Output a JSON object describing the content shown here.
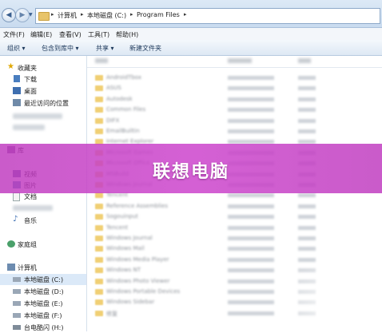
{
  "address": {
    "crumbs": [
      "计算机",
      "本地磁盘 (C:)",
      "Program Files"
    ]
  },
  "menu": [
    "文件(F)",
    "编辑(E)",
    "查看(V)",
    "工具(T)",
    "帮助(H)"
  ],
  "toolbar": [
    "组织 ▾",
    "包含到库中 ▾",
    "共享 ▾",
    "新建文件夹"
  ],
  "nav": {
    "favorites_label": "收藏夹",
    "favorites": [
      "下载",
      "桌面",
      "最近访问的位置"
    ],
    "library_label": "库",
    "libraries": [
      "视频",
      "图片",
      "文档",
      "音乐"
    ],
    "homegroup_label": "家庭组",
    "computer_label": "计算机",
    "drives": [
      "本地磁盘 (C:)",
      "本地磁盘 (D:)",
      "本地磁盘 (E:)",
      "本地磁盘 (F:)",
      "台电酷闪 (H:)"
    ]
  },
  "files": [
    "AndroidTbox",
    "ASUS",
    "Autodesk",
    "Common Files",
    "DIFX",
    "EmailBuiltin",
    "Internet Explorer",
    "Microsoft Games",
    "Microsoft Office",
    "MSBuild",
    "Windows Journal",
    "Tencent",
    "Reference Assemblies",
    "Sogouinput",
    "Tencent",
    "Windows Journal",
    "Windows Mail",
    "Windows Media Player",
    "Windows NT",
    "Windows Photo Viewer",
    "Windows Portable Devices",
    "Windows Sidebar",
    "修复"
  ],
  "banner": {
    "title": "联想电脑"
  }
}
